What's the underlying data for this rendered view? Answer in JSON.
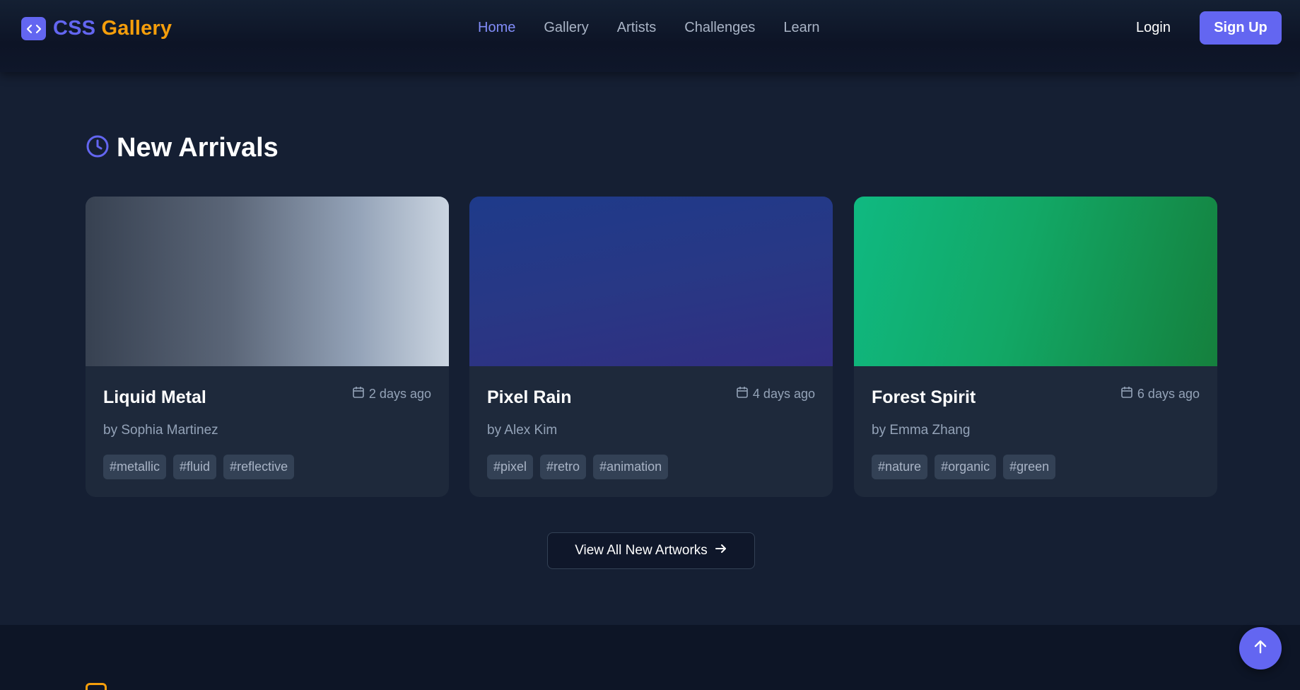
{
  "header": {
    "logo_css": "CSS",
    "logo_gallery": "Gallery",
    "nav": [
      "Home",
      "Gallery",
      "Artists",
      "Challenges",
      "Learn"
    ],
    "active_nav": "Home",
    "login_label": "Login",
    "signup_label": "Sign Up"
  },
  "section": {
    "title": "New Arrivals",
    "icon": "clock-icon",
    "cards": [
      {
        "title": "Liquid Metal",
        "date": "2 days ago",
        "author": "by Sophia Martinez",
        "tags": [
          "#metallic",
          "#fluid",
          "#reflective"
        ],
        "gradient": [
          "#374151",
          "#64748b",
          "#cbd5e1"
        ]
      },
      {
        "title": "Pixel Rain",
        "date": "4 days ago",
        "author": "by Alex Kim",
        "tags": [
          "#pixel",
          "#retro",
          "#animation"
        ],
        "gradient": [
          "#1e3a8a",
          "#312e81"
        ]
      },
      {
        "title": "Forest Spirit",
        "date": "6 days ago",
        "author": "by Emma Zhang",
        "tags": [
          "#nature",
          "#organic",
          "#green"
        ],
        "gradient": [
          "#10b981",
          "#15803d"
        ]
      }
    ],
    "view_all_label": "View All New Artworks"
  },
  "colors": {
    "accent": "#6366f1",
    "brand_secondary": "#f59e0b",
    "page_bg": "#0f172a",
    "section_bg": "#151f33",
    "card_bg": "#1e293b"
  },
  "next_section": {
    "icon": "trophy-icon",
    "title": ""
  },
  "back_to_top_icon": "arrow-up-icon"
}
